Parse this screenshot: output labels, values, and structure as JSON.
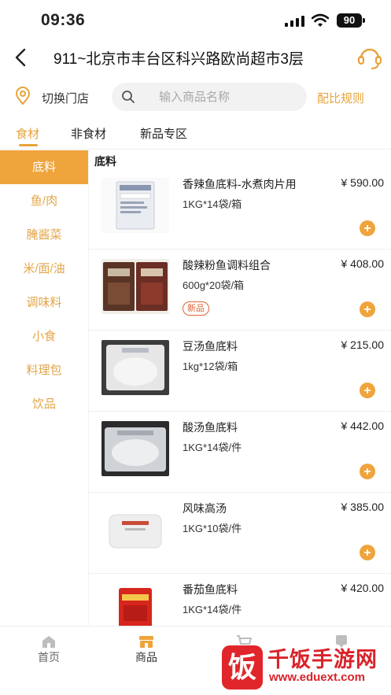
{
  "status_bar": {
    "time": "09:36",
    "battery": "90"
  },
  "header": {
    "title": "911~北京市丰台区科兴路欧尚超市3层"
  },
  "search_row": {
    "switch_store": "切换门店",
    "search_placeholder": "输入商品名称",
    "rules_link": "配比规则"
  },
  "tabs": [
    {
      "label": "食材",
      "active": true
    },
    {
      "label": "非食材",
      "active": false
    },
    {
      "label": "新品专区",
      "active": false
    }
  ],
  "sidebar": {
    "items": [
      {
        "label": "底料",
        "active": true
      },
      {
        "label": "鱼/肉"
      },
      {
        "label": "腌酱菜"
      },
      {
        "label": "米/面/油"
      },
      {
        "label": "调味料"
      },
      {
        "label": "小食"
      },
      {
        "label": "料理包"
      },
      {
        "label": "饮品"
      }
    ]
  },
  "content": {
    "section_title": "底料",
    "products": [
      {
        "name": "香辣鱼底料-水煮肉片用",
        "price": "¥ 590.00",
        "spec": "1KG*14袋/箱",
        "badge": ""
      },
      {
        "name": "酸辣粉鱼调料组合",
        "price": "¥ 408.00",
        "spec": "600g*20袋/箱",
        "badge": "新品"
      },
      {
        "name": "豆汤鱼底料",
        "price": "¥ 215.00",
        "spec": "1kg*12袋/箱",
        "badge": ""
      },
      {
        "name": "酸汤鱼底料",
        "price": "¥ 442.00",
        "spec": "1KG*14袋/件",
        "badge": ""
      },
      {
        "name": "风味高汤",
        "price": "¥ 385.00",
        "spec": "1KG*10袋/件",
        "badge": ""
      },
      {
        "name": "番茄鱼底料",
        "price": "¥ 420.00",
        "spec": "1KG*14袋/件",
        "badge": ""
      }
    ],
    "add_symbol": "+"
  },
  "bottom_nav": [
    {
      "label": "首页",
      "icon": "home-icon"
    },
    {
      "label": "商品",
      "icon": "shop-icon",
      "active": true
    },
    {
      "label": "",
      "icon": "cart-icon"
    },
    {
      "label": "",
      "icon": "profile-icon"
    }
  ],
  "watermark": {
    "logo": "饭",
    "title": "千饭手游网",
    "url": "www.eduext.com"
  },
  "colors": {
    "accent": "#efa43c",
    "accent_text": "#e8a33a",
    "badge": "#e0632f",
    "watermark": "#d9232a"
  }
}
